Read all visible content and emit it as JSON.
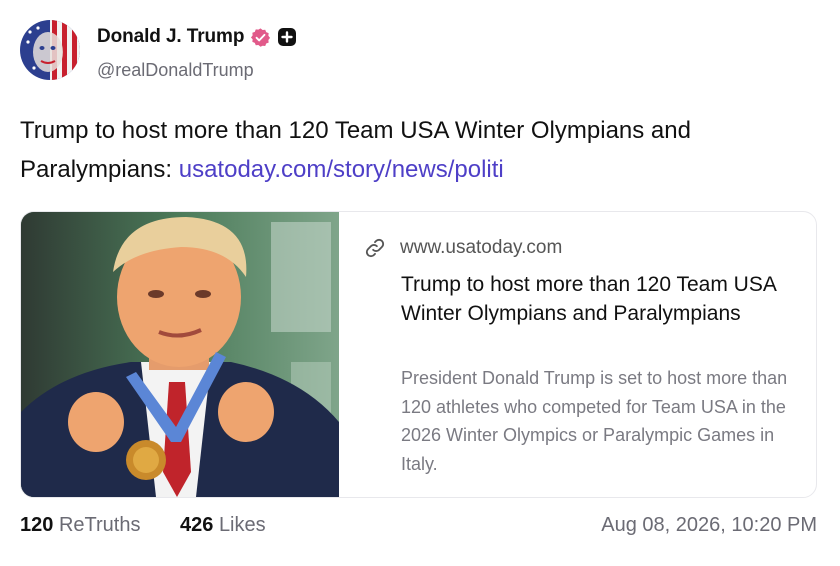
{
  "author": {
    "display_name": "Donald J. Trump",
    "handle": "@realDonaldTrump",
    "avatar_icon": "avatar-flag-face",
    "verified_icon": "verified-badge-icon",
    "verified_color": "#e15a8a",
    "plus_icon": "plus-square-icon"
  },
  "post": {
    "text": "Trump to host more than 120 Team USA Winter Olympians and Paralympians: ",
    "link_text": "usatoday.com/story/news/politi",
    "link_color": "#4e3fc7"
  },
  "card": {
    "image_alt": "Trump holding a gold medal",
    "link_icon": "link-icon",
    "domain": "www.usatoday.com",
    "title": "Trump to host more than 120 Team USA Winter Olympians and Paralympians",
    "description": "President Donald Trump is set to host more than 120 athletes who competed for Team USA in the 2026 Winter Olympics or Paralympic Games in Italy."
  },
  "footer": {
    "retruths_count": "120",
    "retruths_label": "ReTruths",
    "likes_count": "426",
    "likes_label": "Likes",
    "timestamp": "Aug 08, 2026, 10:20 PM"
  }
}
